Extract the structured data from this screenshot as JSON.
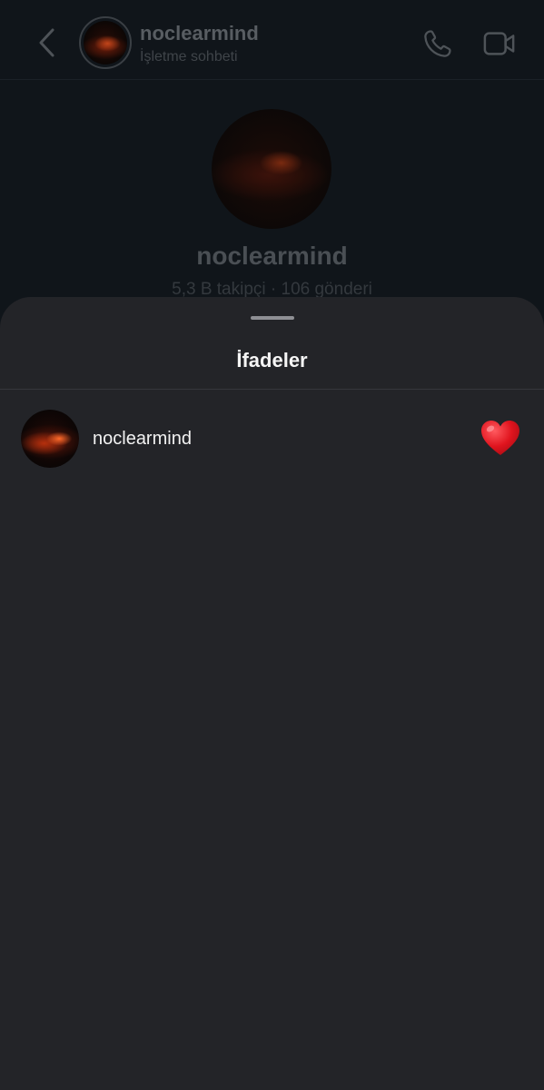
{
  "chat": {
    "username": "noclearmind",
    "subtitle": "İşletme sohbeti",
    "profile_name": "noclearmind",
    "profile_stats": "5,3 B takipçi · 106 gönderi"
  },
  "icons": {
    "back": "chevron-left-icon",
    "call": "phone-icon",
    "video": "video-camera-icon",
    "reaction": "red-heart-emoji"
  },
  "sheet": {
    "title": "İfadeler",
    "reactions": [
      {
        "username": "noclearmind",
        "emoji": "❤️"
      }
    ]
  },
  "colors": {
    "sheet_bg": "#232428",
    "screen_bg": "#10151a",
    "heart": "#e0141e"
  }
}
